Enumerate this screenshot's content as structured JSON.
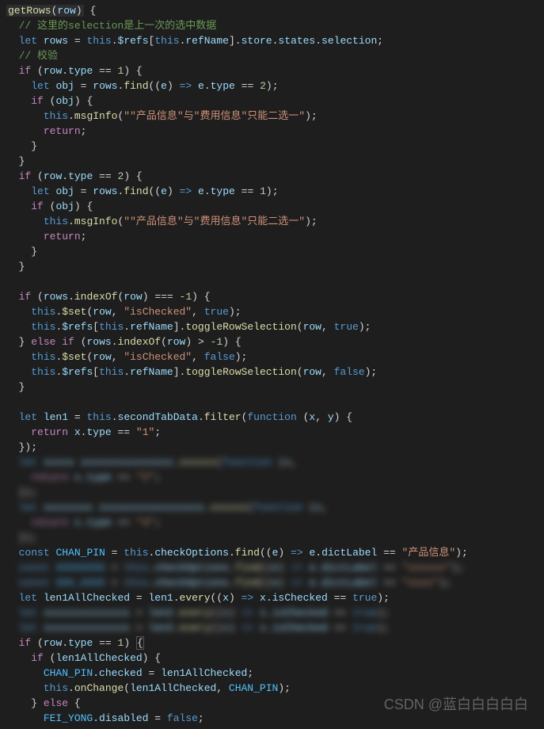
{
  "code": {
    "l1_fn": "getRows",
    "l1_param": "row",
    "l2_comment": "// 这里的selection是上一次的选中数据",
    "l3_let": "let",
    "l3_rows": "rows",
    "l3_this": "this",
    "l3_refs": "$refs",
    "l3_refName": "refName",
    "l3_store": "store",
    "l3_states": "states",
    "l3_selection": "selection",
    "l4_comment": "// 校验",
    "l5_if": "if",
    "l5_row": "row",
    "l5_type": "type",
    "l5_eq": "==",
    "l5_one": "1",
    "l6_let": "let",
    "l6_obj": "obj",
    "l6_rows": "rows",
    "l6_find": "find",
    "l6_e": "e",
    "l6_arrow": "=>",
    "l6_type": "type",
    "l6_two": "2",
    "l7_if": "if",
    "l7_obj": "obj",
    "l8_this": "this",
    "l8_msgInfo": "msgInfo",
    "l8_str": "\"\"产品信息\"与\"费用信息\"只能二选一\"",
    "l9_return": "return",
    "l12_if": "if",
    "l12_two": "2",
    "l13_one": "1",
    "l19_if": "if",
    "l19_indexOf": "indexOf",
    "l19_minus1": "-1",
    "l19_eqeq": "===",
    "l20_set": "$set",
    "l20_isChecked": "\"isChecked\"",
    "l20_true": "true",
    "l21_toggleRowSelection": "toggleRowSelection",
    "l22_else": "else",
    "l22_gt": ">",
    "l23_false": "false",
    "l27_len1": "len1",
    "l27_secondTabData": "secondTabData",
    "l27_filter": "filter",
    "l27_function": "function",
    "l27_x": "x",
    "l27_y": "y",
    "l28_return": "return",
    "l28_x": "x",
    "l28_type": "type",
    "l28_str1": "\"1\"",
    "l34_const": "const",
    "l34_CHAN_PIN": "CHAN_PIN",
    "l34_checkOptions": "checkOptions",
    "l34_find": "find",
    "l34_dictLabel": "dictLabel",
    "l34_str": "\"产品信息\"",
    "l36_len1AllChecked": "len1AllChecked",
    "l36_every": "every",
    "l36_isChecked": "isChecked",
    "l39_if": "if",
    "l40_if": "if",
    "l41_checked": "checked",
    "l42_onChange": "onChange",
    "l43_else": "else",
    "l44_FEI_YONG": "FEI_YONG",
    "l44_disabled": "disabled"
  },
  "watermark": "CSDN @蓝白白白白白"
}
